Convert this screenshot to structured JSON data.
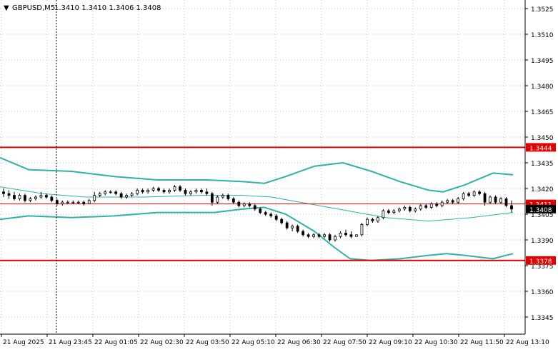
{
  "header": {
    "arrow": "▼",
    "symbol": "GBPUSD,M5",
    "ohlc": "1.3410 1.3410 1.3406 1.3408"
  },
  "colors": {
    "background": "#ffffff",
    "grid": "#c8c8c8",
    "candle": "#000000",
    "band": "#2fb3a8",
    "level": "#e00000",
    "price_tag": "#000000"
  },
  "chart_data": {
    "type": "candlestick",
    "symbol": "GBPUSD",
    "timeframe": "M5",
    "ylim": [
      1.3335,
      1.353
    ],
    "y_ticks": [
      "1.3525",
      "1.3510",
      "1.3495",
      "1.3480",
      "1.3465",
      "1.3450",
      "1.3435",
      "1.3420",
      "1.3405",
      "1.3390",
      "1.3375",
      "1.3360",
      "1.3345"
    ],
    "x_ticks": [
      "21 Aug 2025",
      "21 Aug 23:45",
      "22 Aug 01:05",
      "22 Aug 02:30",
      "22 Aug 03:50",
      "22 Aug 05:10",
      "22 Aug 06:30",
      "22 Aug 07:50",
      "22 Aug 09:10",
      "22 Aug 10:30",
      "22 Aug 11:50",
      "22 Aug 13:10"
    ],
    "levels": [
      {
        "value": 1.3444,
        "label": "1.3444"
      },
      {
        "value": 1.3378,
        "label": "1.3378"
      }
    ],
    "bid_line": {
      "value": 1.3411,
      "label": "1.3411"
    },
    "current_price": {
      "value": 1.3408,
      "label": "1.3408"
    },
    "band_series": [
      {
        "role": "upper",
        "values": [
          [
            0,
            1.3438
          ],
          [
            40,
            1.3431
          ],
          [
            100,
            1.343
          ],
          [
            160,
            1.3427
          ],
          [
            220,
            1.3425
          ],
          [
            290,
            1.3425
          ],
          [
            340,
            1.3424
          ],
          [
            370,
            1.3423
          ],
          [
            400,
            1.3427
          ],
          [
            440,
            1.3433
          ],
          [
            480,
            1.3435
          ],
          [
            520,
            1.343
          ],
          [
            560,
            1.3424
          ],
          [
            600,
            1.3419
          ],
          [
            620,
            1.3418
          ],
          [
            650,
            1.3422
          ],
          [
            690,
            1.3429
          ],
          [
            718,
            1.3428
          ]
        ]
      },
      {
        "role": "middle",
        "values": [
          [
            0,
            1.3421
          ],
          [
            60,
            1.3417
          ],
          [
            120,
            1.3415
          ],
          [
            200,
            1.3415
          ],
          [
            280,
            1.3416
          ],
          [
            340,
            1.3416
          ],
          [
            380,
            1.3415
          ],
          [
            420,
            1.3412
          ],
          [
            460,
            1.3409
          ],
          [
            500,
            1.3406
          ],
          [
            540,
            1.3403
          ],
          [
            600,
            1.3401
          ],
          [
            660,
            1.3403
          ],
          [
            718,
            1.3406
          ]
        ]
      },
      {
        "role": "lower",
        "values": [
          [
            0,
            1.3402
          ],
          [
            40,
            1.3404
          ],
          [
            100,
            1.3403
          ],
          [
            160,
            1.3404
          ],
          [
            220,
            1.3406
          ],
          [
            300,
            1.3406
          ],
          [
            340,
            1.3408
          ],
          [
            370,
            1.3409
          ],
          [
            400,
            1.3405
          ],
          [
            440,
            1.3395
          ],
          [
            470,
            1.3385
          ],
          [
            490,
            1.3379
          ],
          [
            520,
            1.3378
          ],
          [
            560,
            1.3379
          ],
          [
            600,
            1.3381
          ],
          [
            625,
            1.3382
          ],
          [
            650,
            1.3381
          ],
          [
            690,
            1.3379
          ],
          [
            718,
            1.3382
          ]
        ]
      }
    ],
    "candles": [
      [
        1.3418,
        1.342,
        1.3415,
        1.3417
      ],
      [
        1.3417,
        1.3419,
        1.3414,
        1.3416
      ],
      [
        1.3416,
        1.3418,
        1.3413,
        1.3414
      ],
      [
        1.3414,
        1.3417,
        1.3413,
        1.3416
      ],
      [
        1.3416,
        1.3417,
        1.3412,
        1.3413
      ],
      [
        1.3413,
        1.3415,
        1.3412,
        1.3414
      ],
      [
        1.3414,
        1.3416,
        1.3413,
        1.3415
      ],
      [
        1.3415,
        1.3418,
        1.3414,
        1.3416
      ],
      [
        1.3416,
        1.3417,
        1.3414,
        1.3415
      ],
      [
        1.3415,
        1.3416,
        1.3412,
        1.3413
      ],
      [
        1.3413,
        1.3414,
        1.341,
        1.3411
      ],
      [
        1.3411,
        1.3413,
        1.341,
        1.3412
      ],
      [
        1.3412,
        1.3413,
        1.3411,
        1.3412
      ],
      [
        1.3412,
        1.3413,
        1.3411,
        1.3412
      ],
      [
        1.3412,
        1.3413,
        1.3411,
        1.3412
      ],
      [
        1.3412,
        1.3413,
        1.341,
        1.3411
      ],
      [
        1.3411,
        1.3414,
        1.3411,
        1.3413
      ],
      [
        1.3413,
        1.3418,
        1.3412,
        1.3416
      ],
      [
        1.3416,
        1.3418,
        1.3415,
        1.3417
      ],
      [
        1.3417,
        1.3419,
        1.3416,
        1.3418
      ],
      [
        1.3418,
        1.3419,
        1.3417,
        1.3418
      ],
      [
        1.3418,
        1.3419,
        1.3416,
        1.3417
      ],
      [
        1.3417,
        1.3418,
        1.3414,
        1.3415
      ],
      [
        1.3415,
        1.3417,
        1.3414,
        1.3416
      ],
      [
        1.3416,
        1.3418,
        1.3415,
        1.3417
      ],
      [
        1.3417,
        1.342,
        1.3416,
        1.3419
      ],
      [
        1.3419,
        1.342,
        1.3417,
        1.3418
      ],
      [
        1.3418,
        1.342,
        1.3417,
        1.3419
      ],
      [
        1.3419,
        1.3421,
        1.3418,
        1.342
      ],
      [
        1.342,
        1.3421,
        1.3418,
        1.3419
      ],
      [
        1.3419,
        1.342,
        1.3417,
        1.3418
      ],
      [
        1.3418,
        1.342,
        1.3417,
        1.3419
      ],
      [
        1.3419,
        1.3422,
        1.3418,
        1.3421
      ],
      [
        1.3421,
        1.3422,
        1.3418,
        1.3419
      ],
      [
        1.3419,
        1.342,
        1.3416,
        1.3417
      ],
      [
        1.3417,
        1.3419,
        1.3416,
        1.3418
      ],
      [
        1.3418,
        1.342,
        1.3417,
        1.3419
      ],
      [
        1.3419,
        1.342,
        1.3417,
        1.3418
      ],
      [
        1.3418,
        1.342,
        1.3416,
        1.3417
      ],
      [
        1.3417,
        1.3418,
        1.341,
        1.3412
      ],
      [
        1.3412,
        1.3416,
        1.3411,
        1.3415
      ],
      [
        1.3415,
        1.3417,
        1.3414,
        1.3416
      ],
      [
        1.3416,
        1.3417,
        1.3413,
        1.3414
      ],
      [
        1.3414,
        1.3415,
        1.3411,
        1.3412
      ],
      [
        1.3412,
        1.3413,
        1.3409,
        1.341
      ],
      [
        1.341,
        1.3412,
        1.3409,
        1.3411
      ],
      [
        1.3411,
        1.3412,
        1.3409,
        1.341
      ],
      [
        1.341,
        1.3411,
        1.3407,
        1.3408
      ],
      [
        1.3408,
        1.3409,
        1.3405,
        1.3406
      ],
      [
        1.3406,
        1.3407,
        1.3404,
        1.3405
      ],
      [
        1.3405,
        1.3406,
        1.3403,
        1.3404
      ],
      [
        1.3404,
        1.3405,
        1.3401,
        1.3402
      ],
      [
        1.3402,
        1.3403,
        1.3399,
        1.34
      ],
      [
        1.34,
        1.3401,
        1.3396,
        1.3397
      ],
      [
        1.3397,
        1.3399,
        1.3395,
        1.3398
      ],
      [
        1.3398,
        1.3399,
        1.3394,
        1.3395
      ],
      [
        1.3395,
        1.3396,
        1.3392,
        1.3393
      ],
      [
        1.3393,
        1.3394,
        1.3391,
        1.3392
      ],
      [
        1.3392,
        1.3394,
        1.3391,
        1.3393
      ],
      [
        1.3393,
        1.3394,
        1.3391,
        1.3392
      ],
      [
        1.3392,
        1.3394,
        1.3391,
        1.3393
      ],
      [
        1.3393,
        1.3394,
        1.3389,
        1.339
      ],
      [
        1.339,
        1.3393,
        1.3389,
        1.3392
      ],
      [
        1.3392,
        1.3395,
        1.3391,
        1.3394
      ],
      [
        1.3394,
        1.3396,
        1.3392,
        1.3393
      ],
      [
        1.3393,
        1.3395,
        1.3391,
        1.3392
      ],
      [
        1.3392,
        1.3393,
        1.3392,
        1.3393
      ],
      [
        1.3393,
        1.34,
        1.3392,
        1.3399
      ],
      [
        1.3399,
        1.3403,
        1.3398,
        1.3402
      ],
      [
        1.3402,
        1.3403,
        1.34,
        1.3401
      ],
      [
        1.3401,
        1.3404,
        1.34,
        1.3403
      ],
      [
        1.3403,
        1.3408,
        1.3402,
        1.3407
      ],
      [
        1.3407,
        1.3408,
        1.3405,
        1.3406
      ],
      [
        1.3406,
        1.3408,
        1.3405,
        1.3407
      ],
      [
        1.3407,
        1.3409,
        1.3406,
        1.3408
      ],
      [
        1.3408,
        1.341,
        1.3407,
        1.3409
      ],
      [
        1.3409,
        1.341,
        1.3406,
        1.3407
      ],
      [
        1.3407,
        1.3409,
        1.3406,
        1.3408
      ],
      [
        1.3408,
        1.3411,
        1.3407,
        1.341
      ],
      [
        1.341,
        1.3411,
        1.3408,
        1.3409
      ],
      [
        1.3409,
        1.3412,
        1.3408,
        1.3411
      ],
      [
        1.3411,
        1.3412,
        1.3409,
        1.341
      ],
      [
        1.341,
        1.3413,
        1.3409,
        1.3412
      ],
      [
        1.3412,
        1.3414,
        1.3411,
        1.3413
      ],
      [
        1.3413,
        1.3414,
        1.3411,
        1.3412
      ],
      [
        1.3412,
        1.3415,
        1.3411,
        1.3414
      ],
      [
        1.3414,
        1.3418,
        1.3413,
        1.3417
      ],
      [
        1.3417,
        1.3418,
        1.3415,
        1.3416
      ],
      [
        1.3416,
        1.3419,
        1.3415,
        1.3418
      ],
      [
        1.3418,
        1.3419,
        1.3416,
        1.3417
      ],
      [
        1.3417,
        1.3418,
        1.341,
        1.3412
      ],
      [
        1.3412,
        1.3416,
        1.3411,
        1.3415
      ],
      [
        1.3415,
        1.3416,
        1.3411,
        1.3412
      ],
      [
        1.3412,
        1.3415,
        1.3411,
        1.3414
      ],
      [
        1.3414,
        1.3415,
        1.3409,
        1.341
      ],
      [
        1.341,
        1.3413,
        1.3406,
        1.3408
      ]
    ]
  }
}
